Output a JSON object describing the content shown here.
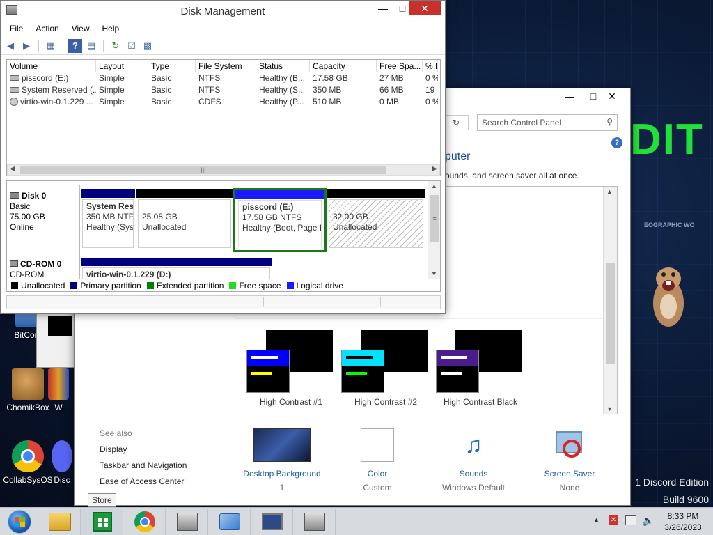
{
  "desktop": {
    "watermark_text": "DIT",
    "geo_text": "EOGRAPHIC WO",
    "edition_line": "1 Discord Edition",
    "build_line": "Build 9600",
    "icons": [
      {
        "label": "BitCom"
      },
      {
        "label": "ChomikBox"
      },
      {
        "label": "W"
      },
      {
        "label": "CollabSysOS"
      },
      {
        "label": "Disc"
      }
    ]
  },
  "disk_mgmt": {
    "title": "Disk Management",
    "menu": [
      "File",
      "Action",
      "View",
      "Help"
    ],
    "columns": [
      "Volume",
      "Layout",
      "Type",
      "File System",
      "Status",
      "Capacity",
      "Free Spa...",
      "% F"
    ],
    "rows": [
      [
        "pisscord (E:)",
        "Simple",
        "Basic",
        "NTFS",
        "Healthy (B...",
        "17.58 GB",
        "27 MB",
        "0 %"
      ],
      [
        "System Reserved (...",
        "Simple",
        "Basic",
        "NTFS",
        "Healthy (S...",
        "350 MB",
        "66 MB",
        "19"
      ],
      [
        "virtio-win-0.1.229 ...",
        "Simple",
        "Basic",
        "CDFS",
        "Healthy (P...",
        "510 MB",
        "0 MB",
        "0 %"
      ]
    ],
    "disk0": {
      "name": "Disk 0",
      "type": "Basic",
      "size": "75.00 GB",
      "state": "Online"
    },
    "partitions": [
      {
        "name": "System Res",
        "l2": "350 MB NTF",
        "l3": "Healthy (Sys"
      },
      {
        "name": "",
        "l2": "25.08 GB",
        "l3": "Unallocated"
      },
      {
        "name": "pisscord  (E:)",
        "l2": "17.58 GB NTFS",
        "l3": "Healthy (Boot, Page I"
      },
      {
        "name": "",
        "l2": "32.00 GB",
        "l3": "Unallocated"
      }
    ],
    "cdrom": {
      "name": "CD-ROM 0",
      "type": "CD-ROM",
      "volume": "virtio-win-0.1.229  (D:)"
    },
    "legend": [
      {
        "label": "Unallocated",
        "color": "#000000"
      },
      {
        "label": "Primary partition",
        "color": "#00007f"
      },
      {
        "label": "Extended partition",
        "color": "#008000"
      },
      {
        "label": "Free space",
        "color": "#22dd22"
      },
      {
        "label": "Logical drive",
        "color": "#1a1aff"
      }
    ]
  },
  "control_panel": {
    "search_placeholder": "Search Control Panel",
    "heading_fragment": "puter",
    "desc_fragment": "ounds, and screen saver all at once.",
    "themes": [
      {
        "label": "High Contrast #1",
        "bar": "#0000ff",
        "stripe": "#ffff00"
      },
      {
        "label": "High Contrast #2",
        "bar": "#00e0ff",
        "stripe": "#00ff00"
      },
      {
        "label": "High Contrast Black",
        "bar": "#4b1c8c",
        "stripe": "#ffffff"
      }
    ],
    "see_also": {
      "title": "See also",
      "links": [
        "Display",
        "Taskbar and Navigation",
        "Ease of Access Center"
      ]
    },
    "bottom": [
      {
        "label": "Desktop Background",
        "value": "1"
      },
      {
        "label": "Color",
        "value": "Custom"
      },
      {
        "label": "Sounds",
        "value": "Windows Default"
      },
      {
        "label": "Screen Saver",
        "value": "None"
      }
    ]
  },
  "tooltip": "Store",
  "tray": {
    "time": "8:33 PM",
    "date": "3/26/2023"
  }
}
